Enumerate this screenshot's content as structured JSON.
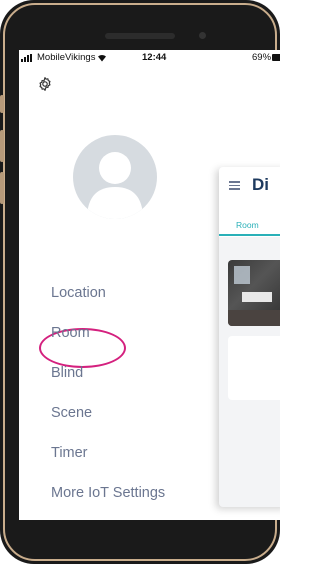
{
  "status_bar": {
    "carrier": "MobileVikings",
    "time": "12:44",
    "battery": "69%"
  },
  "sidebar": {
    "settings_icon": "gear-icon",
    "avatar_icon": "user-placeholder-icon",
    "items": [
      {
        "label": "Location"
      },
      {
        "label": "Room"
      },
      {
        "label": "Blind"
      },
      {
        "label": "Scene"
      },
      {
        "label": "Timer"
      },
      {
        "label": "More IoT Settings"
      }
    ],
    "highlight_color": "#d4207e",
    "text_color": "#6b7690"
  },
  "main_panel": {
    "menu_icon": "hamburger-icon",
    "title": "Di",
    "tab": "Room",
    "accent_color": "#2ab0b8"
  }
}
